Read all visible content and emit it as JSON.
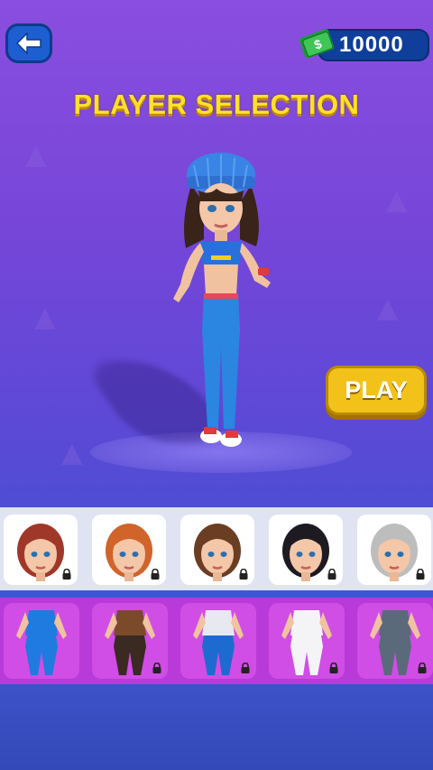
{
  "header": {
    "back_icon": "arrow-left-icon",
    "currency_icon": "cash-icon",
    "currency_amount": "10000"
  },
  "title": "PLAYER SELECTION",
  "play_button": "PLAY",
  "colors": {
    "title": "#ffe02a",
    "play": "#f2c21a",
    "back": "#1d5fd0",
    "outfit_strip": "#b83ad8",
    "heads_strip": "#dfe3f2"
  },
  "heads": [
    {
      "name": "red-hair-head",
      "hair": "#a0382a",
      "locked": true,
      "selected": false
    },
    {
      "name": "ginger-bun-head",
      "hair": "#d0642a",
      "locked": true,
      "selected": false
    },
    {
      "name": "brown-bun-head",
      "hair": "#6b3d22",
      "locked": true,
      "selected": false
    },
    {
      "name": "black-bob-head",
      "hair": "#1e1a22",
      "locked": true,
      "selected": false
    },
    {
      "name": "beanie-gray-head",
      "hair": "#bdbdbd",
      "locked": true,
      "selected": false
    }
  ],
  "outfits": [
    {
      "name": "blue-crop-outfit",
      "top": "#1f7be0",
      "bottom": "#1f7be0",
      "locked": false,
      "selected": true
    },
    {
      "name": "brown-jacket-outfit",
      "top": "#7a4a2a",
      "bottom": "#3a2a22",
      "locked": true,
      "selected": false
    },
    {
      "name": "striped-overalls-outfit",
      "top": "#e8e8f0",
      "bottom": "#1d6bd0",
      "locked": true,
      "selected": false
    },
    {
      "name": "white-suit-outfit",
      "top": "#f4f4f6",
      "bottom": "#f4f4f6",
      "locked": true,
      "selected": false
    },
    {
      "name": "gray-bodysuit-outfit",
      "top": "#5a6a7a",
      "bottom": "#5a6a7a",
      "locked": true,
      "selected": false
    }
  ]
}
